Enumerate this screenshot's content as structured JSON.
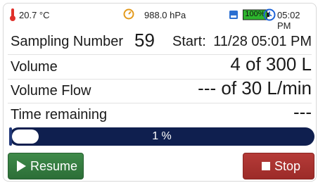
{
  "status_bar": {
    "temperature": "20.7 °C",
    "pressure": "988.0 hPa",
    "battery": "100%",
    "time": "05:02 PM",
    "colors": {
      "thermometer": "#e0302a",
      "barometer": "#e39a1c",
      "battery_fill": "#2db52d",
      "clock": "#1e63d6"
    }
  },
  "sampling": {
    "label": "Sampling Number",
    "number": "59",
    "start_label": "Start:",
    "start_value": "11/28 05:01 PM"
  },
  "volume": {
    "label": "Volume",
    "value": "4 of 300 L"
  },
  "volume_flow": {
    "label": "Volume Flow",
    "value": "--- of 30 L/min"
  },
  "time_remaining": {
    "label": "Time remaining",
    "value": "---"
  },
  "progress": {
    "percent": 1,
    "text": "1 %"
  },
  "buttons": {
    "resume": "Resume",
    "stop": "Stop",
    "colors": {
      "resume": "#2f7a3a",
      "stop": "#a8302d"
    }
  }
}
